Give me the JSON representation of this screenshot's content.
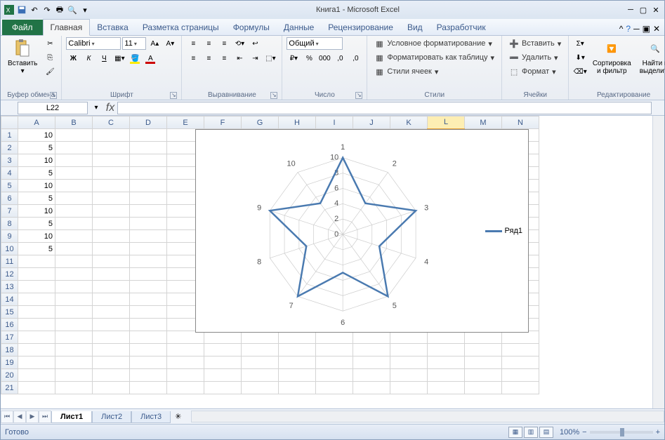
{
  "app_title": "Книга1 - Microsoft Excel",
  "menu": {
    "file": "Файл",
    "tabs": [
      "Главная",
      "Вставка",
      "Разметка страницы",
      "Формулы",
      "Данные",
      "Рецензирование",
      "Вид",
      "Разработчик"
    ],
    "active": 0
  },
  "ribbon": {
    "clipboard": {
      "label": "Буфер обмена",
      "paste": "Вставить"
    },
    "font": {
      "label": "Шрифт",
      "name": "Calibri",
      "size": "11"
    },
    "alignment": {
      "label": "Выравнивание"
    },
    "number": {
      "label": "Число",
      "format": "Общий"
    },
    "styles": {
      "label": "Стили",
      "cond": "Условное форматирование",
      "table": "Форматировать как таблицу",
      "cell": "Стили ячеек"
    },
    "cells": {
      "label": "Ячейки",
      "insert": "Вставить",
      "delete": "Удалить",
      "format": "Формат"
    },
    "editing": {
      "label": "Редактирование",
      "sort": "Сортировка\nи фильтр",
      "find": "Найти и\nвыделить"
    }
  },
  "namebox": "L22",
  "columns": [
    "A",
    "B",
    "C",
    "D",
    "E",
    "F",
    "G",
    "H",
    "I",
    "J",
    "K",
    "L",
    "M",
    "N"
  ],
  "selected_col_index": 11,
  "rows": 21,
  "cells": {
    "A1": "10",
    "A2": "5",
    "A3": "10",
    "A4": "5",
    "A5": "10",
    "A6": "5",
    "A7": "10",
    "A8": "5",
    "A9": "10",
    "A10": "5"
  },
  "sheet_tabs": [
    "Лист1",
    "Лист2",
    "Лист3"
  ],
  "active_sheet": 0,
  "status": {
    "ready": "Готово",
    "zoom": "100%"
  },
  "chart_data": {
    "type": "radar",
    "categories": [
      "1",
      "2",
      "3",
      "4",
      "5",
      "6",
      "7",
      "8",
      "9",
      "10"
    ],
    "series": [
      {
        "name": "Ряд1",
        "values": [
          10,
          5,
          10,
          5,
          10,
          5,
          10,
          5,
          10,
          5
        ]
      }
    ],
    "axis_ticks": [
      0,
      2,
      4,
      6,
      8,
      10
    ],
    "max": 10,
    "legend_position": "right"
  }
}
